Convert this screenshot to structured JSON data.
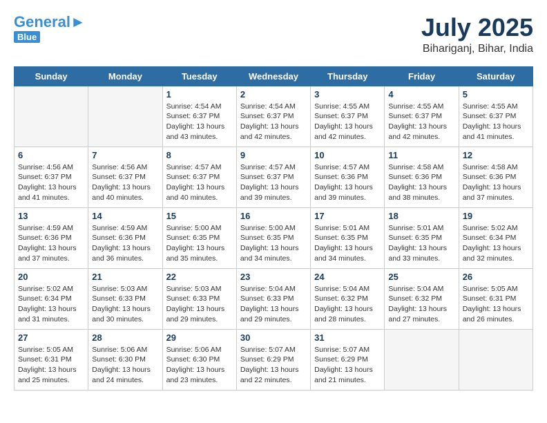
{
  "header": {
    "logo_general": "General",
    "logo_blue": "Blue",
    "month_year": "July 2025",
    "location": "Bihariganj, Bihar, India"
  },
  "days_of_week": [
    "Sunday",
    "Monday",
    "Tuesday",
    "Wednesday",
    "Thursday",
    "Friday",
    "Saturday"
  ],
  "weeks": [
    [
      {
        "day": "",
        "info": ""
      },
      {
        "day": "",
        "info": ""
      },
      {
        "day": "1",
        "info": "Sunrise: 4:54 AM\nSunset: 6:37 PM\nDaylight: 13 hours and 43 minutes."
      },
      {
        "day": "2",
        "info": "Sunrise: 4:54 AM\nSunset: 6:37 PM\nDaylight: 13 hours and 42 minutes."
      },
      {
        "day": "3",
        "info": "Sunrise: 4:55 AM\nSunset: 6:37 PM\nDaylight: 13 hours and 42 minutes."
      },
      {
        "day": "4",
        "info": "Sunrise: 4:55 AM\nSunset: 6:37 PM\nDaylight: 13 hours and 42 minutes."
      },
      {
        "day": "5",
        "info": "Sunrise: 4:55 AM\nSunset: 6:37 PM\nDaylight: 13 hours and 41 minutes."
      }
    ],
    [
      {
        "day": "6",
        "info": "Sunrise: 4:56 AM\nSunset: 6:37 PM\nDaylight: 13 hours and 41 minutes."
      },
      {
        "day": "7",
        "info": "Sunrise: 4:56 AM\nSunset: 6:37 PM\nDaylight: 13 hours and 40 minutes."
      },
      {
        "day": "8",
        "info": "Sunrise: 4:57 AM\nSunset: 6:37 PM\nDaylight: 13 hours and 40 minutes."
      },
      {
        "day": "9",
        "info": "Sunrise: 4:57 AM\nSunset: 6:37 PM\nDaylight: 13 hours and 39 minutes."
      },
      {
        "day": "10",
        "info": "Sunrise: 4:57 AM\nSunset: 6:36 PM\nDaylight: 13 hours and 39 minutes."
      },
      {
        "day": "11",
        "info": "Sunrise: 4:58 AM\nSunset: 6:36 PM\nDaylight: 13 hours and 38 minutes."
      },
      {
        "day": "12",
        "info": "Sunrise: 4:58 AM\nSunset: 6:36 PM\nDaylight: 13 hours and 37 minutes."
      }
    ],
    [
      {
        "day": "13",
        "info": "Sunrise: 4:59 AM\nSunset: 6:36 PM\nDaylight: 13 hours and 37 minutes."
      },
      {
        "day": "14",
        "info": "Sunrise: 4:59 AM\nSunset: 6:36 PM\nDaylight: 13 hours and 36 minutes."
      },
      {
        "day": "15",
        "info": "Sunrise: 5:00 AM\nSunset: 6:35 PM\nDaylight: 13 hours and 35 minutes."
      },
      {
        "day": "16",
        "info": "Sunrise: 5:00 AM\nSunset: 6:35 PM\nDaylight: 13 hours and 34 minutes."
      },
      {
        "day": "17",
        "info": "Sunrise: 5:01 AM\nSunset: 6:35 PM\nDaylight: 13 hours and 34 minutes."
      },
      {
        "day": "18",
        "info": "Sunrise: 5:01 AM\nSunset: 6:35 PM\nDaylight: 13 hours and 33 minutes."
      },
      {
        "day": "19",
        "info": "Sunrise: 5:02 AM\nSunset: 6:34 PM\nDaylight: 13 hours and 32 minutes."
      }
    ],
    [
      {
        "day": "20",
        "info": "Sunrise: 5:02 AM\nSunset: 6:34 PM\nDaylight: 13 hours and 31 minutes."
      },
      {
        "day": "21",
        "info": "Sunrise: 5:03 AM\nSunset: 6:33 PM\nDaylight: 13 hours and 30 minutes."
      },
      {
        "day": "22",
        "info": "Sunrise: 5:03 AM\nSunset: 6:33 PM\nDaylight: 13 hours and 29 minutes."
      },
      {
        "day": "23",
        "info": "Sunrise: 5:04 AM\nSunset: 6:33 PM\nDaylight: 13 hours and 29 minutes."
      },
      {
        "day": "24",
        "info": "Sunrise: 5:04 AM\nSunset: 6:32 PM\nDaylight: 13 hours and 28 minutes."
      },
      {
        "day": "25",
        "info": "Sunrise: 5:04 AM\nSunset: 6:32 PM\nDaylight: 13 hours and 27 minutes."
      },
      {
        "day": "26",
        "info": "Sunrise: 5:05 AM\nSunset: 6:31 PM\nDaylight: 13 hours and 26 minutes."
      }
    ],
    [
      {
        "day": "27",
        "info": "Sunrise: 5:05 AM\nSunset: 6:31 PM\nDaylight: 13 hours and 25 minutes."
      },
      {
        "day": "28",
        "info": "Sunrise: 5:06 AM\nSunset: 6:30 PM\nDaylight: 13 hours and 24 minutes."
      },
      {
        "day": "29",
        "info": "Sunrise: 5:06 AM\nSunset: 6:30 PM\nDaylight: 13 hours and 23 minutes."
      },
      {
        "day": "30",
        "info": "Sunrise: 5:07 AM\nSunset: 6:29 PM\nDaylight: 13 hours and 22 minutes."
      },
      {
        "day": "31",
        "info": "Sunrise: 5:07 AM\nSunset: 6:29 PM\nDaylight: 13 hours and 21 minutes."
      },
      {
        "day": "",
        "info": ""
      },
      {
        "day": "",
        "info": ""
      }
    ]
  ]
}
